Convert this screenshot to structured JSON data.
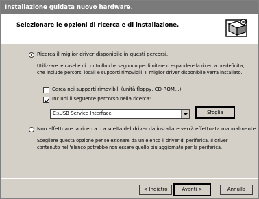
{
  "window": {
    "title": "Installazione guidata nuovo hardware."
  },
  "header": {
    "title": "Selezionare le opzioni di ricerca e di installazione.",
    "icon": "hardware-wizard-icon"
  },
  "options": {
    "search": {
      "label": "Ricerca il miglior driver disponibile in questi percorsi.",
      "selected": true,
      "description_line1": "Utilizzare le caselle di controllo che seguono per limitare o espandere la ricerca predefinita,",
      "description_line2": "che include percorsi locali e supporti rimovibili. Il miglior driver disponibile verrà installato.",
      "removable_media": {
        "label": "Cerca nei supporti rimovibili (unità floppy, CD-ROM...)",
        "checked": false
      },
      "include_path": {
        "label": "Includi il seguente percorso nella ricerca:",
        "checked": true
      },
      "path_value": "C:\\USB Service Interface",
      "browse_label": "Sfoglia"
    },
    "manual": {
      "label": "Non effettuare la ricerca. La scelta del driver da installare verrà effettuata manualmente.",
      "selected": false,
      "description_line1": "Scegliere questa opzione per selezionare da un elenco il driver di periferica. Il driver",
      "description_line2": "contenuto nell'elenco potrebbe non essere quello più aggiornato per la periferica."
    }
  },
  "footer": {
    "back_label": "< Indietro",
    "next_label": "Avanti >",
    "cancel_label": "Annulla"
  }
}
